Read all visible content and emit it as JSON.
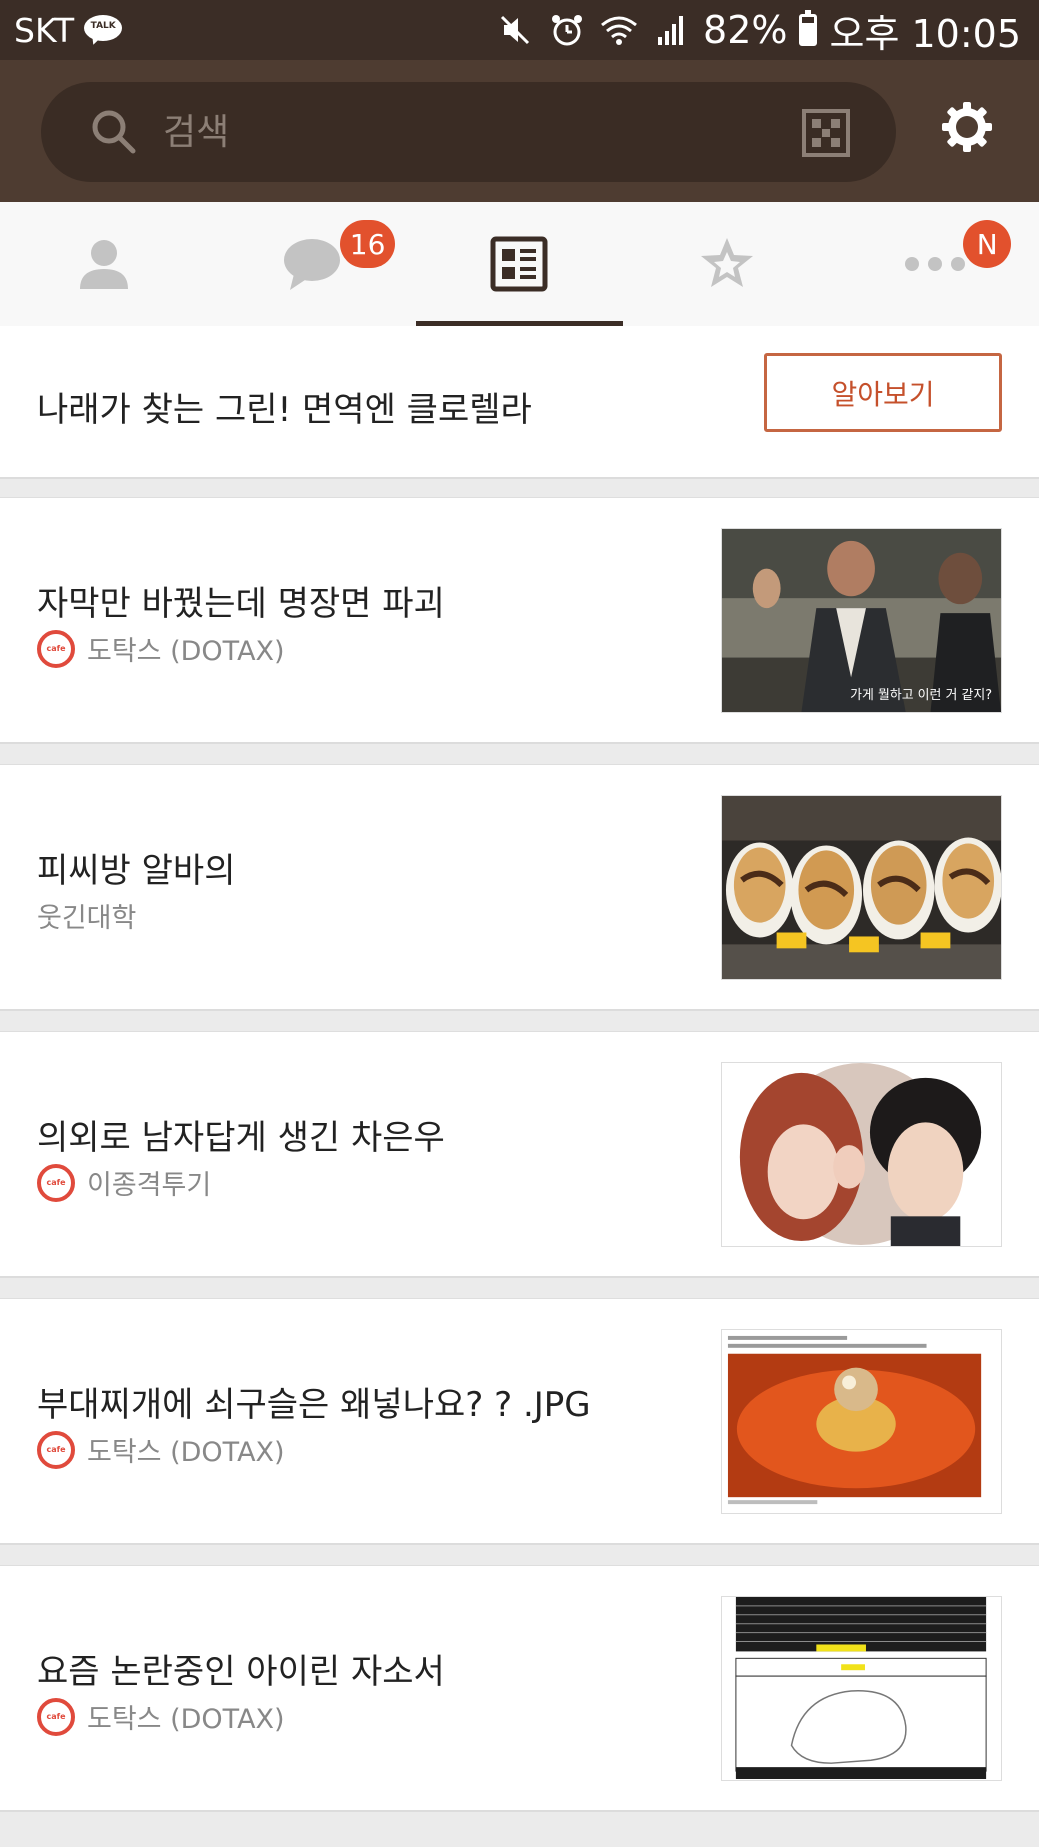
{
  "status_bar": {
    "carrier": "SKT",
    "talk_badge": "TALK",
    "battery": "82%",
    "time": "오후 10:05",
    "icons": [
      "mute-icon",
      "alarm-icon",
      "wifi-icon",
      "signal-icon",
      "battery-icon"
    ]
  },
  "search": {
    "placeholder": "검색"
  },
  "tabs": [
    {
      "name": "friends",
      "icon": "person-icon",
      "badge": ""
    },
    {
      "name": "chats",
      "icon": "chat-bubble-icon",
      "badge": "16"
    },
    {
      "name": "news",
      "icon": "news-icon",
      "badge": ""
    },
    {
      "name": "sharp-search",
      "icon": "star-icon",
      "badge": ""
    },
    {
      "name": "more",
      "icon": "more-icon",
      "badge": "N"
    }
  ],
  "banner": {
    "text": "나래가 찾는 그린! 면역엔 클로렐라",
    "button_label": "알아보기"
  },
  "feed": [
    {
      "title": "자막만 바꿨는데 명장면 파괴",
      "source": "도탁스 (DOTAX)",
      "has_cafe_icon": true,
      "thumb_caption": "가게 뭘하고 이런 거 같지?"
    },
    {
      "title": "피씨방 알바의",
      "source": "웃긴대학",
      "has_cafe_icon": false,
      "thumb_caption": ""
    },
    {
      "title": "의외로 남자답게 생긴 차은우",
      "source": "이종격투기",
      "has_cafe_icon": true,
      "thumb_caption": ""
    },
    {
      "title": "부대찌개에 쇠구슬은 왜넣나요? ?  .JPG",
      "source": "도탁스 (DOTAX)",
      "has_cafe_icon": true,
      "thumb_caption": ""
    },
    {
      "title": "요즘 논란중인 아이린 자소서",
      "source": "도탁스 (DOTAX)",
      "has_cafe_icon": true,
      "thumb_caption": ""
    }
  ],
  "cafe_icon_label": "cafe",
  "colors": {
    "header_brown": "#4e3c31",
    "status_brown": "#3b2d26",
    "badge_orange": "#e2512d",
    "accent_button": "#c5502b"
  }
}
